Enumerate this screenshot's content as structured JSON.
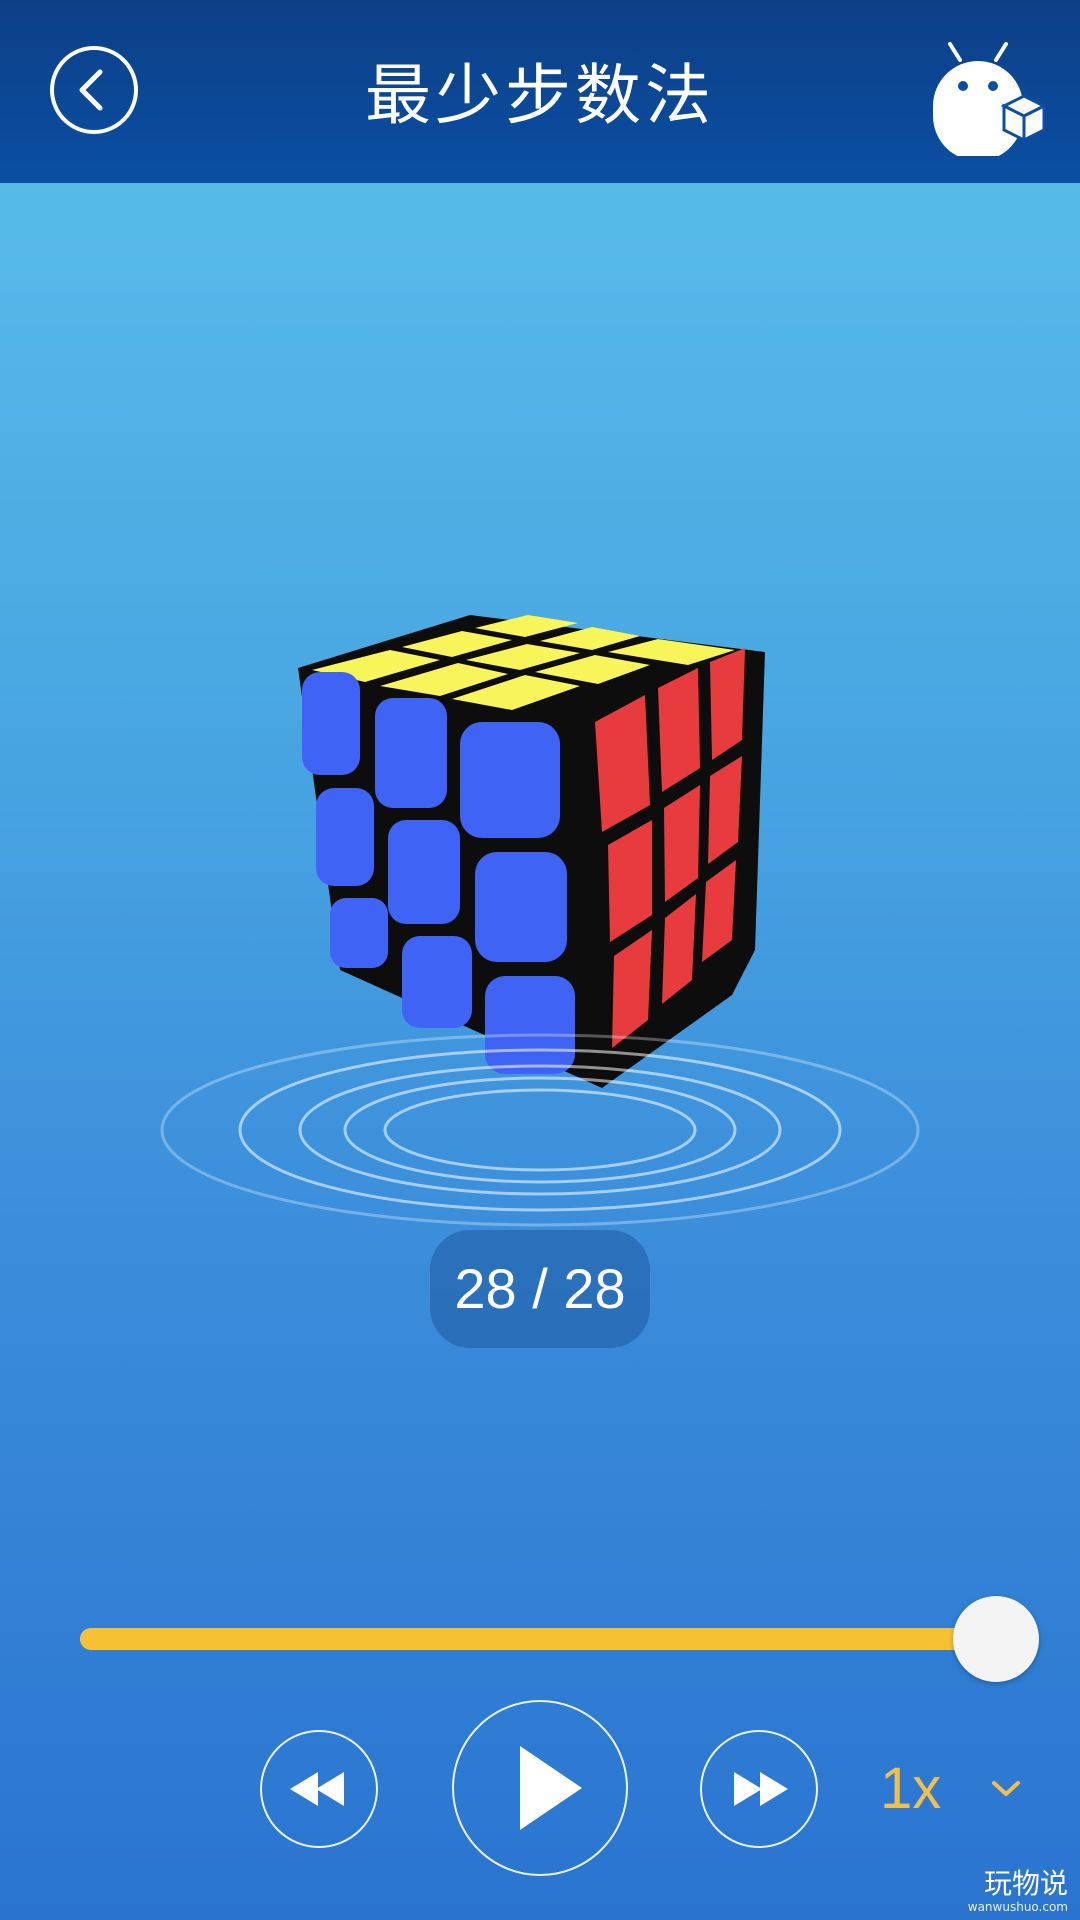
{
  "header": {
    "title": "最少步数法"
  },
  "icons": {
    "back": "back-chevron-icon",
    "mascot": "robot-cube-icon",
    "rewind": "rewind-icon",
    "play": "play-icon",
    "forward": "fast-forward-icon",
    "speed_dropdown": "chevron-down-icon"
  },
  "cube": {
    "top_face": "yellow",
    "left_face": "blue",
    "right_face": "red"
  },
  "progress": {
    "counter_text": "28 / 28",
    "current": 28,
    "total": 28,
    "fraction": 1.0
  },
  "playback": {
    "speed_label": "1x"
  },
  "watermark": {
    "main": "玩物说",
    "sub": "wanwushuo.com"
  },
  "colors": {
    "header": "#0a4fa3",
    "slider_fill": "#f7c134",
    "speed_text": "#f2c04a",
    "cube_yellow": "#f8f55a",
    "cube_blue": "#3f63f5",
    "cube_red": "#e83b3d"
  }
}
